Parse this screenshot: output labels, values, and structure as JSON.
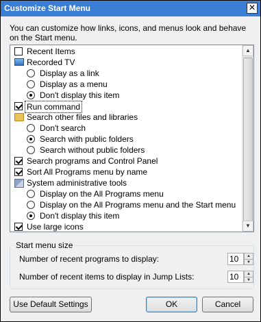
{
  "window": {
    "title": "Customize Start Menu",
    "close": "✕"
  },
  "intro": "You can customize how links, icons, and menus look and behave on the Start menu.",
  "items": [
    {
      "type": "checkbox",
      "level": 0,
      "label": "Recent Items",
      "checked": false
    },
    {
      "type": "header",
      "level": 0,
      "icon": "tv-icon",
      "label": "Recorded TV"
    },
    {
      "type": "radio",
      "level": 1,
      "label": "Display as a link",
      "checked": false
    },
    {
      "type": "radio",
      "level": 1,
      "label": "Display as a menu",
      "checked": false
    },
    {
      "type": "radio",
      "level": 1,
      "label": "Don't display this item",
      "checked": true
    },
    {
      "type": "checkbox",
      "level": 0,
      "label": "Run command",
      "checked": true,
      "selected": true
    },
    {
      "type": "header",
      "level": 0,
      "icon": "folder-icon",
      "label": "Search other files and libraries"
    },
    {
      "type": "radio",
      "level": 1,
      "label": "Don't search",
      "checked": false
    },
    {
      "type": "radio",
      "level": 1,
      "label": "Search with public folders",
      "checked": true
    },
    {
      "type": "radio",
      "level": 1,
      "label": "Search without public folders",
      "checked": false
    },
    {
      "type": "checkbox",
      "level": 0,
      "label": "Search programs and Control Panel",
      "checked": true
    },
    {
      "type": "checkbox",
      "level": 0,
      "label": "Sort All Programs menu by name",
      "checked": true
    },
    {
      "type": "header",
      "level": 0,
      "icon": "admin-tools-icon",
      "label": "System administrative tools"
    },
    {
      "type": "radio",
      "level": 1,
      "label": "Display on the All Programs menu",
      "checked": false
    },
    {
      "type": "radio",
      "level": 1,
      "label": "Display on the All Programs menu and the Start menu",
      "checked": false
    },
    {
      "type": "radio",
      "level": 1,
      "label": "Don't display this item",
      "checked": true
    },
    {
      "type": "checkbox",
      "level": 0,
      "label": "Use large icons",
      "checked": true
    }
  ],
  "start_menu_size": {
    "legend": "Start menu size",
    "recent_programs_label": "Number of recent programs to display:",
    "recent_programs_value": "10",
    "jump_list_label": "Number of recent items to display in Jump Lists:",
    "jump_list_value": "10"
  },
  "buttons": {
    "default_settings": "Use Default Settings",
    "ok": "OK",
    "cancel": "Cancel"
  }
}
